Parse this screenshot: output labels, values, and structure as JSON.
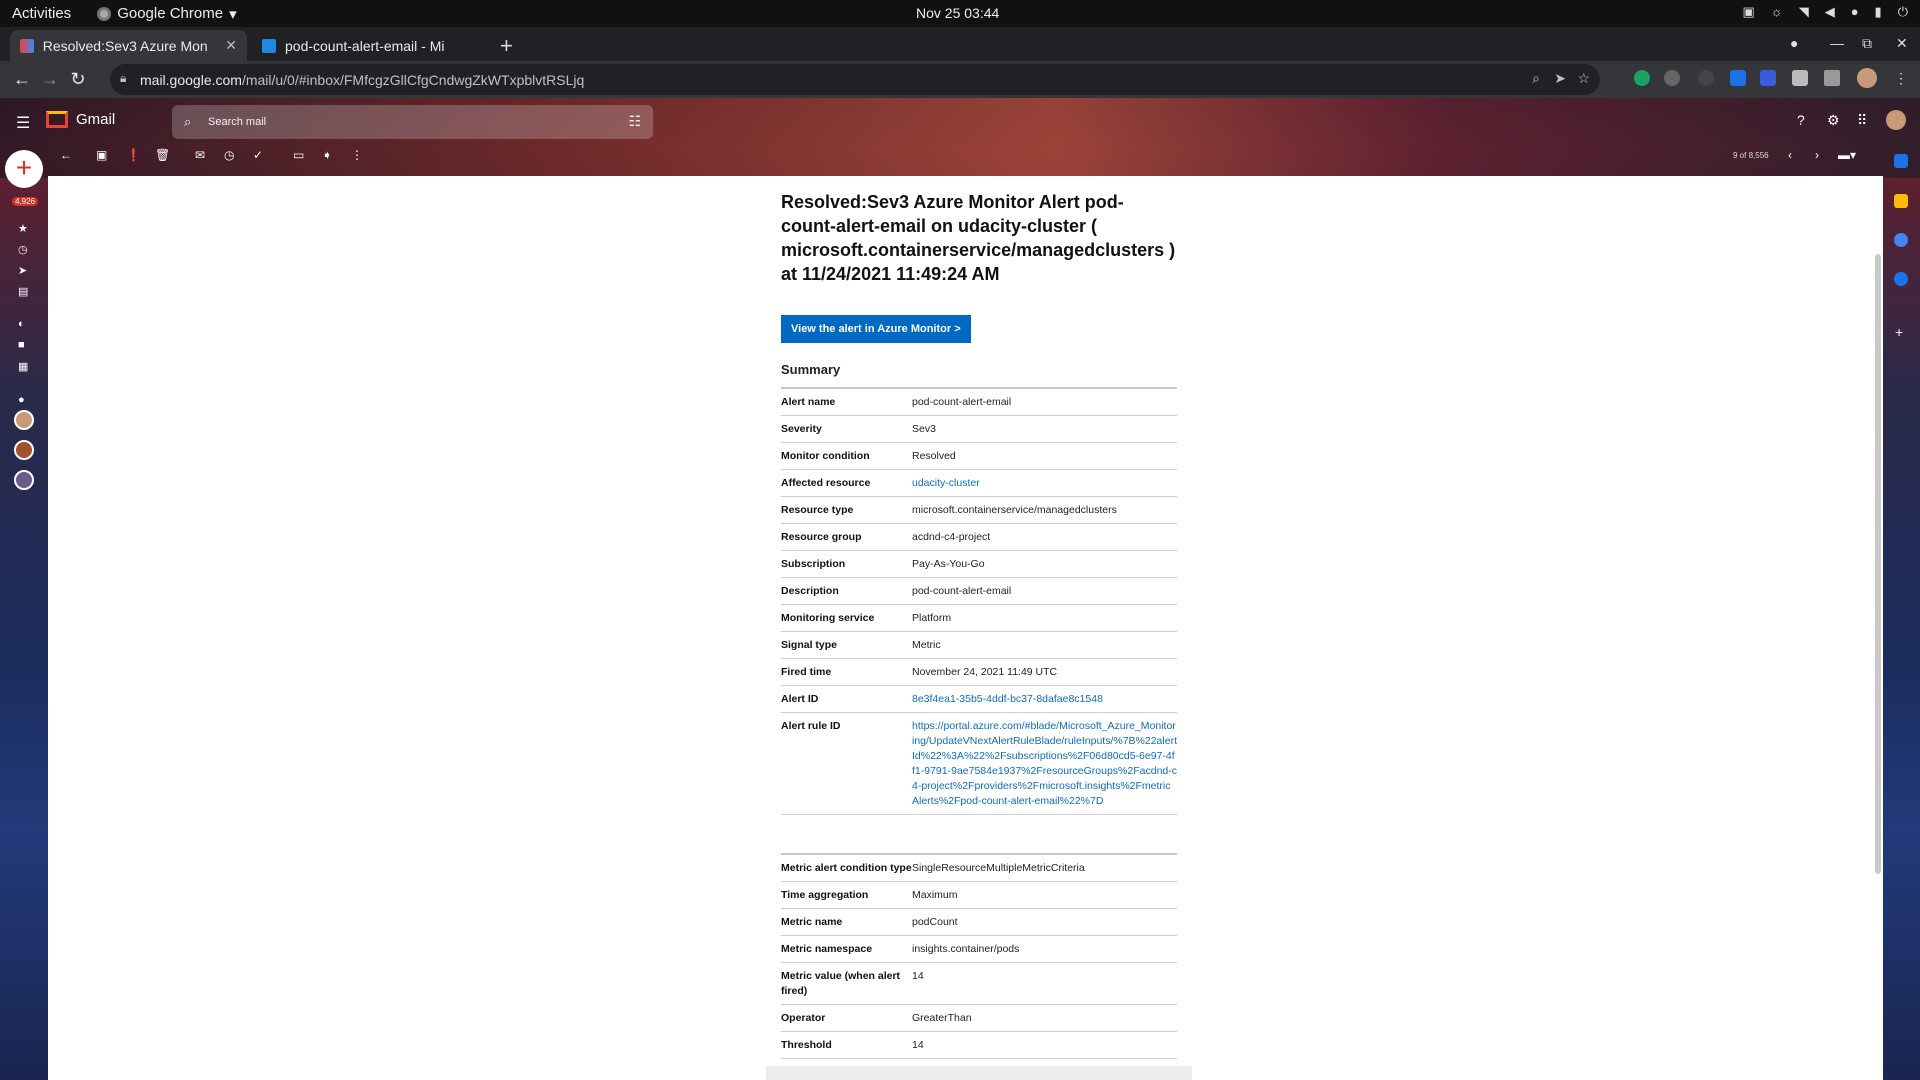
{
  "system": {
    "activities": "Activities",
    "app_name": "Google Chrome",
    "clock": "Nov 25  03:44"
  },
  "browser": {
    "tabs": [
      {
        "title": "Resolved:Sev3 Azure Mon",
        "active": true
      },
      {
        "title": "pod-count-alert-email - Mi",
        "active": false
      }
    ],
    "url_host": "mail.google.com",
    "url_path": "/mail/u/0/#inbox/FMfcgzGllCfgCndwgZkWTxpblvtRSLjq"
  },
  "gmail": {
    "product_name": "Gmail",
    "search_placeholder": "Search mail",
    "unread_count": "4,926",
    "pagination": "9 of 8,556"
  },
  "email": {
    "title": "Resolved:Sev3 Azure Monitor Alert pod-count-alert-email on udacity-cluster ( microsoft.containerservice/managedclusters ) at 11/24/2021 11:49:24 AM",
    "button_label": "View the alert in Azure Monitor >",
    "summary_heading": "Summary",
    "summary": [
      {
        "key": "Alert name",
        "value": "pod-count-alert-email"
      },
      {
        "key": "Severity",
        "value": "Sev3"
      },
      {
        "key": "Monitor condition",
        "value": "Resolved"
      },
      {
        "key": "Affected resource",
        "value": "udacity-cluster",
        "link": true
      },
      {
        "key": "Resource type",
        "value": "microsoft.containerservice/managedclusters"
      },
      {
        "key": "Resource group",
        "value": "acdnd-c4-project"
      },
      {
        "key": "Subscription",
        "value": "Pay-As-You-Go"
      },
      {
        "key": "Description",
        "value": "pod-count-alert-email"
      },
      {
        "key": "Monitoring service",
        "value": "Platform"
      },
      {
        "key": "Signal type",
        "value": "Metric"
      },
      {
        "key": "Fired time",
        "value": "November 24, 2021 11:49 UTC"
      },
      {
        "key": "Alert ID",
        "value": "8e3f4ea1-35b5-4ddf-bc37-8dafae8c1548",
        "link": true
      },
      {
        "key": "Alert rule ID",
        "value": "https://portal.azure.com/#blade/Microsoft_Azure_Monitoring/UpdateVNextAlertRuleBlade/ruleInputs/%7B%22alertId%22%3A%22%2Fsubscriptions%2F06d80cd5-6e97-4ff1-9791-9ae7584e1937%2FresourceGroups%2Facdnd-c4-project%2Fproviders%2Fmicrosoft.insights%2FmetricAlerts%2Fpod-count-alert-email%22%7D",
        "link": true
      }
    ],
    "metric": [
      {
        "key": "Metric alert condition type",
        "value": "SingleResourceMultipleMetricCriteria"
      },
      {
        "key": "Time aggregation",
        "value": "Maximum"
      },
      {
        "key": "Metric name",
        "value": "podCount"
      },
      {
        "key": "Metric namespace",
        "value": "insights.container/pods"
      },
      {
        "key": "Metric value (when alert fired)",
        "value": "14"
      },
      {
        "key": "Operator",
        "value": "GreaterThan"
      },
      {
        "key": "Threshold",
        "value": "14"
      }
    ]
  },
  "colors": {
    "accent_button": "#0069c2",
    "link": "#0f6cbd",
    "badge": "#d93025"
  }
}
